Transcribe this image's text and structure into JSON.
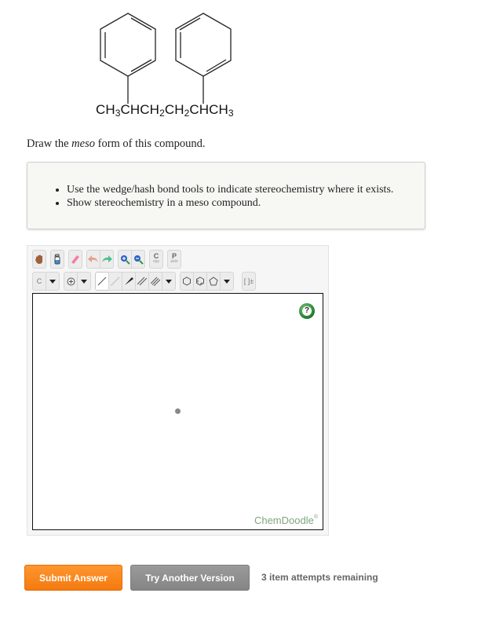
{
  "question": {
    "formula_parts": [
      {
        "t": "CH"
      },
      {
        "s": "3"
      },
      {
        "t": "CHCH"
      },
      {
        "s": "2"
      },
      {
        "t": "CH"
      },
      {
        "s": "2"
      },
      {
        "t": "CHCH"
      },
      {
        "s": "3"
      }
    ],
    "prompt_before": "Draw the ",
    "prompt_emphasis": "meso",
    "prompt_after": " form of this compound.",
    "hints": [
      "Use the wedge/hash bond tools to indicate stereochemistry where it exists.",
      "Show stereochemistry in a meso compound."
    ]
  },
  "sketcher": {
    "toolbar_row1": [
      {
        "name": "pan-tool",
        "icon": "hand-icon"
      },
      {
        "name": "clear-tool",
        "icon": "spray-bottle-icon"
      },
      {
        "name": "erase-tool",
        "icon": "eraser-icon"
      },
      {
        "name": "undo-tool",
        "icon": "undo-arrow-icon"
      },
      {
        "name": "redo-tool",
        "icon": "redo-arrow-icon"
      },
      {
        "name": "zoom-in-tool",
        "icon": "zoom-in-icon"
      },
      {
        "name": "zoom-out-tool",
        "icon": "zoom-out-icon"
      },
      {
        "name": "copy-tool",
        "label": "C",
        "sublabel": "opy"
      },
      {
        "name": "paste-tool",
        "label": "P",
        "sublabel": "aste"
      }
    ],
    "atom_label": "C",
    "bond_tools": [
      "single-bond",
      "hash-bond",
      "wedge-bond",
      "double-bond",
      "triple-bond"
    ],
    "ring_tools": [
      "cyclohexane",
      "benzene",
      "cyclopentane"
    ],
    "charge_label": "[ ]±",
    "help_label": "?",
    "watermark": "ChemDoodle",
    "watermark_mark": "®"
  },
  "actions": {
    "submit_label": "Submit Answer",
    "try_another_label": "Try Another Version",
    "attempts_text": "3 item attempts remaining"
  },
  "colors": {
    "submit": "#f4821c",
    "try_another": "#8e8e8e",
    "help": "#2e8b3a",
    "watermark": "#7ea77e"
  }
}
